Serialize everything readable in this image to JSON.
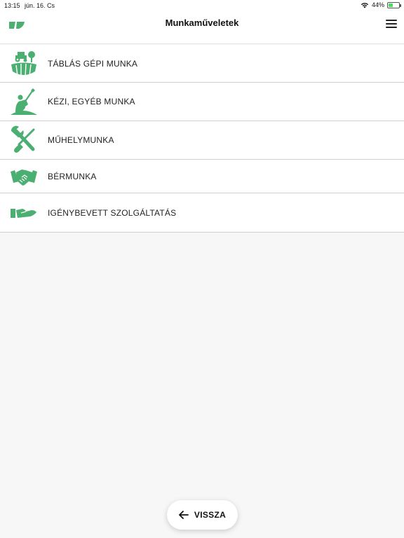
{
  "status_bar": {
    "time": "13:15",
    "date": "jún. 16. Cs",
    "battery": "44%",
    "battery_level": 0.44
  },
  "header": {
    "title": "Munkaműveletek",
    "menu_icon": "hamburger-icon",
    "logo_icon": "app-logo-icon"
  },
  "menu_items": [
    {
      "label": "TÁBLÁS GÉPI MUNKA",
      "icon": "tractor-field-icon"
    },
    {
      "label": "KÉZI, EGYÉB MUNKA",
      "icon": "shovel-icon"
    },
    {
      "label": "MŰHELYMUNKA",
      "icon": "wrench-screwdriver-icon"
    },
    {
      "label": "BÉRMUNKA",
      "icon": "handshake-icon"
    },
    {
      "label": "IGÉNYBEVETT SZOLGÁLTATÁS",
      "icon": "hand-service-icon"
    }
  ],
  "footer": {
    "back_label": "VISSZA",
    "back_icon": "arrow-left-icon"
  },
  "colors": {
    "accent_green": "#4caf72",
    "background": "#f7f7f7",
    "surface": "#ffffff",
    "divider": "#cfcfcf"
  }
}
